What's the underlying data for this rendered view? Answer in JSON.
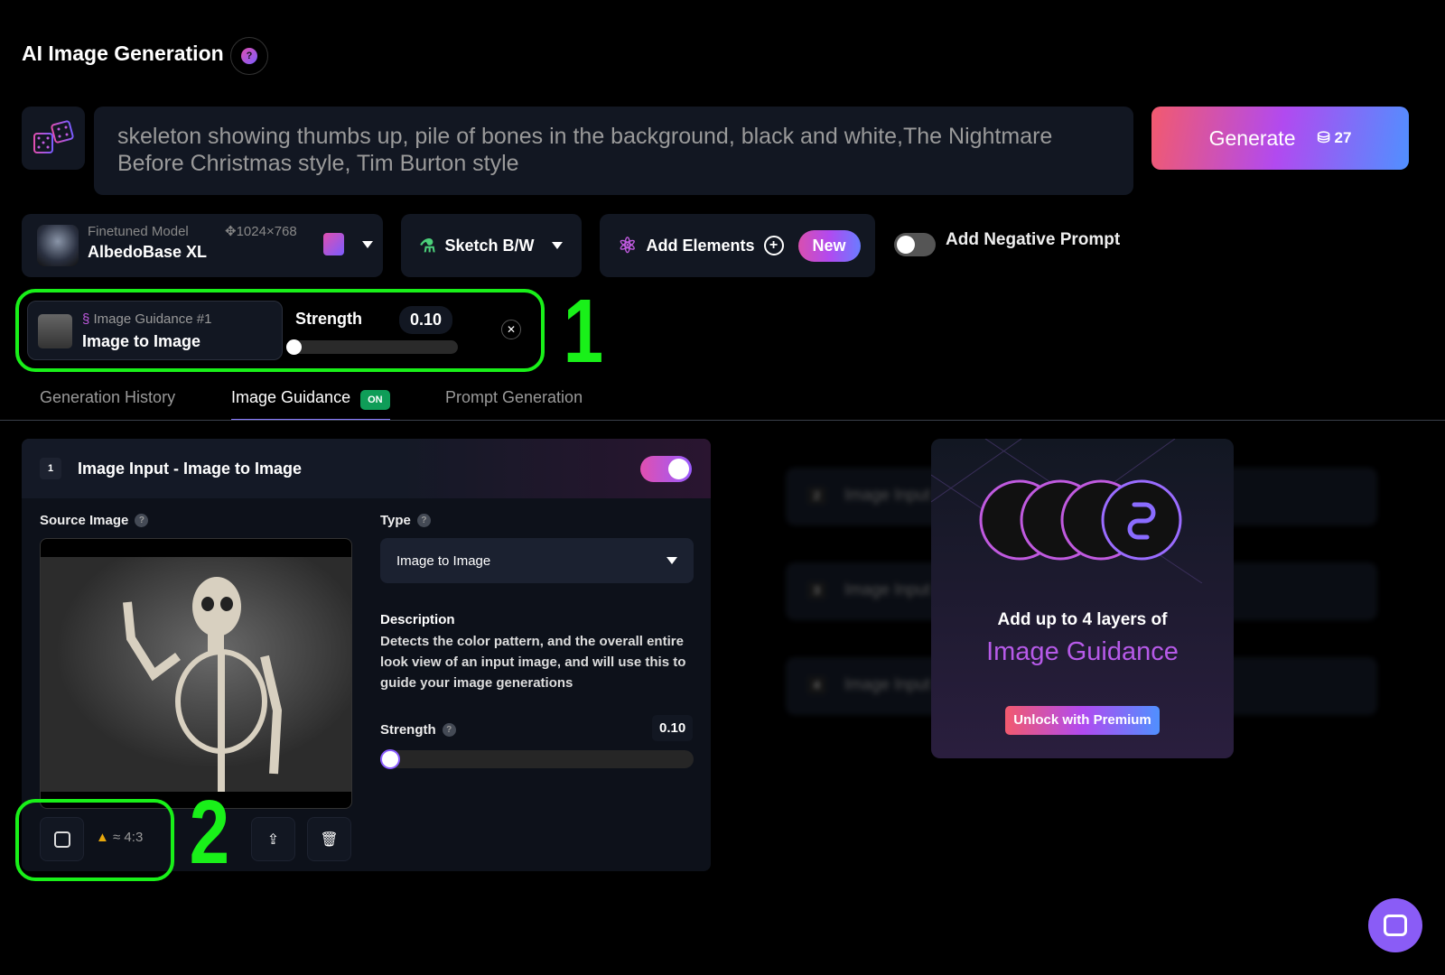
{
  "header": {
    "title": "AI Image Generation",
    "help_icon": "question-icon"
  },
  "prompt": {
    "value": "skeleton showing thumbs up, pile of bones in the background, black and white,The Nightmare Before Christmas style, Tim Burton style"
  },
  "generate": {
    "label": "Generate",
    "credits": "27"
  },
  "model": {
    "caption": "Finetuned Model",
    "name": "AlbedoBase XL",
    "resolution": "1024×768"
  },
  "style": {
    "label": "Sketch B/W"
  },
  "elements": {
    "label": "Add Elements",
    "badge": "New"
  },
  "negative_prompt": {
    "label": "Add Negative Prompt",
    "enabled": false
  },
  "guidance_chip": {
    "caption": "Image Guidance #1",
    "type": "Image to Image",
    "strength_label": "Strength",
    "strength": "0.10"
  },
  "annotations": {
    "one": "1",
    "two": "2"
  },
  "tabs": [
    {
      "label": "Generation History"
    },
    {
      "label": "Image Guidance",
      "badge": "ON",
      "active": true
    },
    {
      "label": "Prompt Generation"
    }
  ],
  "panel": {
    "index": "1",
    "title": "Image Input - Image to Image",
    "enabled": true,
    "source_label": "Source Image",
    "type_label": "Type",
    "type_value": "Image to Image",
    "description_label": "Description",
    "description": "Detects the color pattern, and the overall entire look view of an input image, and will use this to guide your image generations",
    "strength_label": "Strength",
    "strength": "0.10",
    "aspect": "≈ 4:3"
  },
  "locked_rows": [
    {
      "index": "2",
      "label": "Image Input"
    },
    {
      "index": "3",
      "label": "Image Input"
    },
    {
      "index": "4",
      "label": "Image Input"
    }
  ],
  "premium": {
    "line1": "Add up to 4 layers of",
    "line2": "Image Guidance",
    "button": "Unlock with Premium"
  },
  "colors": {
    "accent_pink": "#f25a6e",
    "accent_purple": "#b14af0",
    "accent_blue": "#5090ff",
    "annotation_green": "#19f019",
    "on_badge": "#0f9d58"
  }
}
